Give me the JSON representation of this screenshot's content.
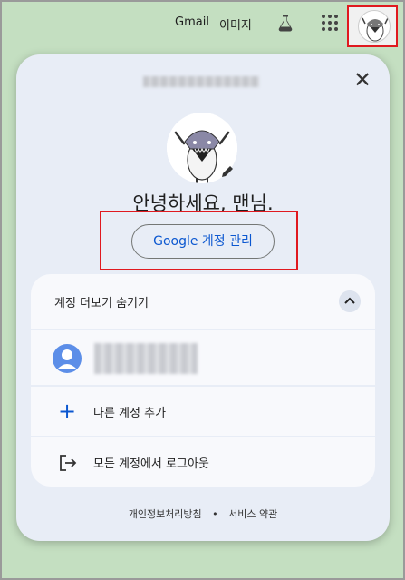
{
  "topbar": {
    "gmail": "Gmail",
    "images": "이미지",
    "labs_icon": "flask-icon",
    "apps_icon": "apps-grid-icon",
    "avatar_icon": "avatar"
  },
  "card": {
    "greeting": "안녕하세요, 맨님.",
    "manage_button": "Google 계정 관리",
    "close_icon": "close-icon",
    "more_accounts_toggle": "계정 더보기 숨기기",
    "add_account": "다른 계정 추가",
    "sign_out_all": "모든 계정에서 로그아웃",
    "footer": {
      "privacy": "개인정보처리방침",
      "separator": "•",
      "terms": "서비스 약관"
    }
  },
  "colors": {
    "background": "#c4dfc1",
    "card": "#e8edf6",
    "accent": "#0b57d0",
    "highlight_box": "#e0191f"
  }
}
